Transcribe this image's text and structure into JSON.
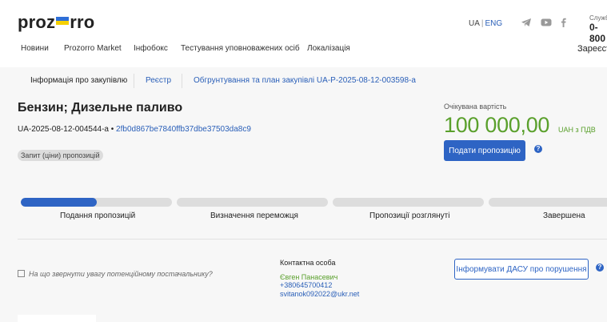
{
  "header": {
    "logo_start": "proz",
    "logo_end": "rro",
    "lang_ua": "UA",
    "lang_sep": "|",
    "lang_eng": "ENG",
    "service_label": "Служб",
    "phone": "0-800",
    "nav": [
      "Новини",
      "Prozorro Market",
      "Інфобокс",
      "Тестування уповноважених осіб",
      "Локалізація"
    ],
    "register": "Зареєст"
  },
  "tabs": {
    "info": "Інформація про закупівлю",
    "registry": "Реєстр",
    "plan": "Обгрунтування та план закупівлі UA-P-2025-08-12-003598-a"
  },
  "tender": {
    "title": "Бензин; Дизельне паливо",
    "id": "UA-2025-08-12-004544-a",
    "bullet": "•",
    "hash": "2fb0d867be7840ffb37dbe37503da8c9",
    "badge": "Запит (ціни) пропозицій"
  },
  "expected": {
    "label": "Очікувана вартість",
    "value": "100 000,00",
    "unit": "UAH з ПДВ",
    "submit": "Подати пропозицію",
    "help": "?"
  },
  "steps": [
    {
      "label": "Подання пропозицій",
      "progress": 0.5
    },
    {
      "label": "Визначення переможця",
      "progress": 0
    },
    {
      "label": "Пропозиції розглянуті",
      "progress": 0
    },
    {
      "label": "Завершена",
      "progress": 0
    }
  ],
  "footer": {
    "note": "На що звернути увагу потенційному постачальнику?",
    "contact_heading": "Контактна особа",
    "contact_name": "Євген Панасевич",
    "contact_phone": "+380645700412",
    "contact_email": "svitanok092022@ukr.net",
    "report": "Інформувати ДАСУ про порушення",
    "help": "?"
  },
  "colors": {
    "accent": "#2e64c4",
    "value_green": "#5aa02c",
    "link": "#2a5fb8"
  },
  "icons": [
    "flag-icon",
    "telegram-icon",
    "youtube-icon",
    "facebook-icon",
    "help-icon",
    "external-link-icon"
  ]
}
